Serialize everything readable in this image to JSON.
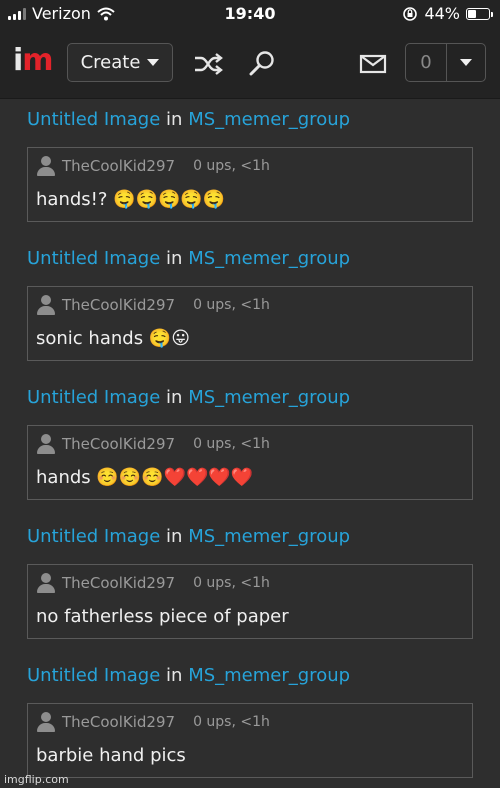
{
  "status_bar": {
    "carrier": "Verizon",
    "time": "19:40",
    "battery": "44%",
    "battery_level": 0.44
  },
  "header": {
    "logo_i": "i",
    "logo_m": "m",
    "create_label": "Create",
    "notification_count": "0"
  },
  "feed": [
    {
      "title": "Untitled Image",
      "in_word": "in",
      "group": "MS_memer_group",
      "username": "TheCoolKid297",
      "meta": "0 ups, <1h",
      "comment": "hands!? 🤤🤤🤤🤤🤤"
    },
    {
      "title": "Untitled Image",
      "in_word": "in",
      "group": "MS_memer_group",
      "username": "TheCoolKid297",
      "meta": "0 ups, <1h",
      "comment": "sonic hands 🤤😛"
    },
    {
      "title": "Untitled Image",
      "in_word": "in",
      "group": "MS_memer_group",
      "username": "TheCoolKid297",
      "meta": "0 ups, <1h",
      "comment": "hands ☺️☺️☺️❤️❤️❤️❤️"
    },
    {
      "title": "Untitled Image",
      "in_word": "in",
      "group": "MS_memer_group",
      "username": "TheCoolKid297",
      "meta": "0 ups, <1h",
      "comment": "no fatherless piece of paper"
    },
    {
      "title": "Untitled Image",
      "in_word": "in",
      "group": "MS_memer_group",
      "username": "TheCoolKid297",
      "meta": "0 ups, <1h",
      "comment": "barbie hand pics"
    }
  ],
  "watermark": "imgflip.com",
  "colors": {
    "background": "#2e2e2e",
    "header_bg": "#232323",
    "link": "#27a3d9",
    "logo_red": "#e2232a",
    "muted_text": "#9a9a9a"
  }
}
